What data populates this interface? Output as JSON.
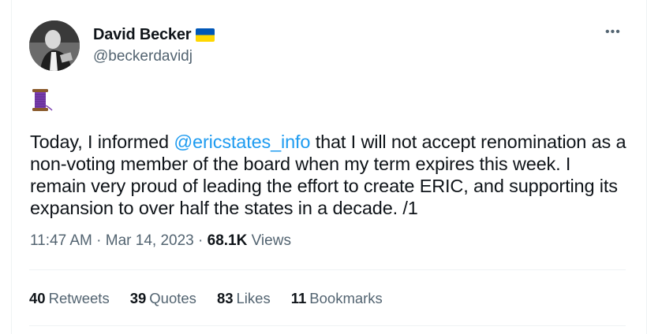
{
  "author": {
    "display_name": "David Becker",
    "handle": "@beckerdavidj",
    "flag_icon": "ukraine-flag-icon",
    "verified_flag_colors": {
      "top": "#0057b7",
      "bottom": "#ffd700"
    }
  },
  "menu": {
    "icon": "more-options-icon",
    "glyph": "•••"
  },
  "emoji": {
    "icon": "thread-spool-icon"
  },
  "tweet": {
    "text_before": "Today, I informed ",
    "mention": "@ericstates_info",
    "text_after": " that I will not accept renomination as a non-voting member of the board when my term expires this week. I remain very proud of leading the effort to create ERIC, and supporting its expansion to over half the states in a decade. /1"
  },
  "meta": {
    "time": "11:47 AM",
    "sep1": " · ",
    "date": "Mar 14, 2023",
    "sep2": " · ",
    "views_count": "68.1K",
    "views_label": " Views"
  },
  "stats": {
    "retweets_count": "40",
    "retweets_label": "Retweets",
    "quotes_count": "39",
    "quotes_label": "Quotes",
    "likes_count": "83",
    "likes_label": "Likes",
    "bookmarks_count": "11",
    "bookmarks_label": "Bookmarks"
  },
  "colors": {
    "link": "#1d9bf0",
    "secondary_text": "#536471",
    "primary_text": "#0f1419",
    "divider": "#eff3f4"
  }
}
